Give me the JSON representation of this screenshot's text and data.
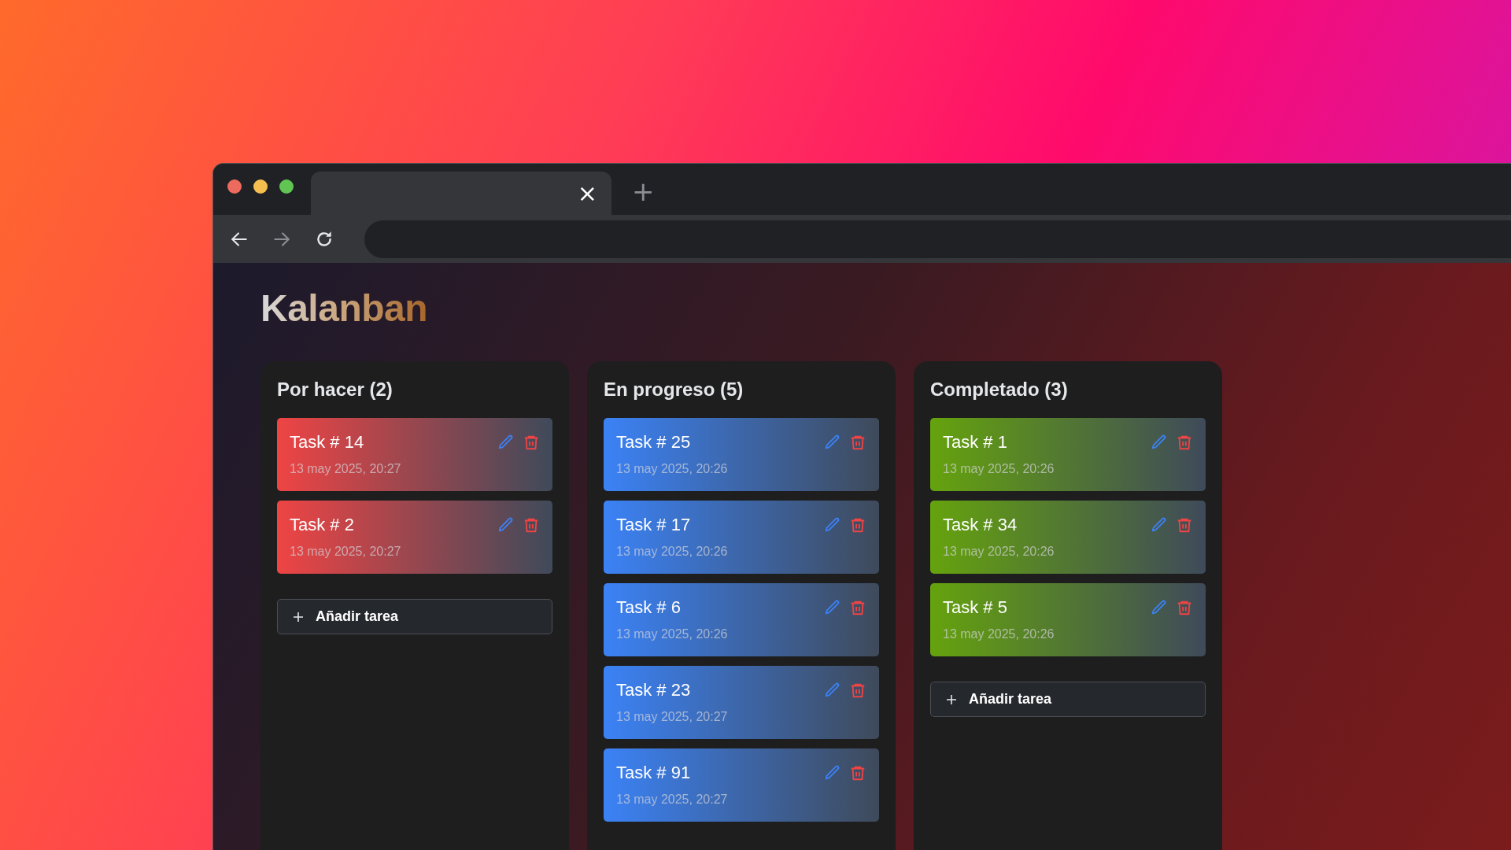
{
  "browser": {
    "tab_close": "×",
    "new_tab": "+"
  },
  "app": {
    "title": "Kalanban"
  },
  "columns": [
    {
      "title": "Por hacer (2)",
      "color": "#ef4444",
      "add_button": "Añadir tarea",
      "cards": [
        {
          "title": "Task # 14",
          "date": "13 may 2025, 20:27"
        },
        {
          "title": "Task # 2",
          "date": "13 may 2025, 20:27"
        }
      ]
    },
    {
      "title": "En progreso (5)",
      "color": "#3b82f6",
      "cards": [
        {
          "title": "Task # 25",
          "date": "13 may 2025, 20:26"
        },
        {
          "title": "Task # 17",
          "date": "13 may 2025, 20:26"
        },
        {
          "title": "Task # 6",
          "date": "13 may 2025, 20:26"
        },
        {
          "title": "Task # 23",
          "date": "13 may 2025, 20:27"
        },
        {
          "title": "Task # 91",
          "date": "13 may 2025, 20:27"
        }
      ]
    },
    {
      "title": "Completado (3)",
      "color": "#65a30d",
      "add_button": "Añadir tarea",
      "cards": [
        {
          "title": "Task # 1",
          "date": "13 may 2025, 20:26"
        },
        {
          "title": "Task # 34",
          "date": "13 may 2025, 20:26"
        },
        {
          "title": "Task # 5",
          "date": "13 may 2025, 20:26"
        }
      ]
    }
  ]
}
